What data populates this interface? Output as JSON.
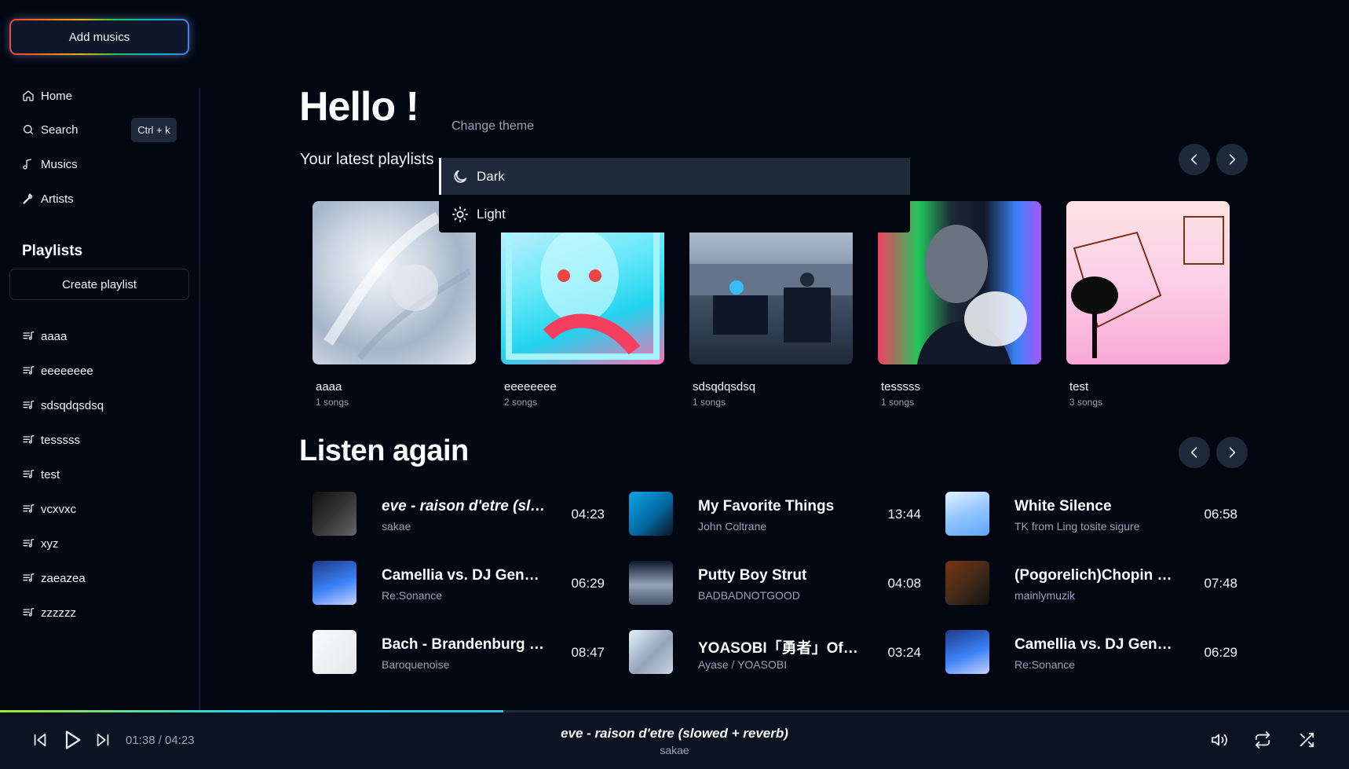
{
  "sidebar": {
    "add_label": "Add musics",
    "nav": [
      {
        "label": "Home",
        "icon": "home-icon"
      },
      {
        "label": "Search",
        "icon": "search-icon",
        "shortcut": "Ctrl + k"
      },
      {
        "label": "Musics",
        "icon": "music-note-icon"
      },
      {
        "label": "Artists",
        "icon": "microphone-icon"
      }
    ],
    "playlists_title": "Playlists",
    "create_label": "Create playlist",
    "playlists": [
      "aaaa",
      "eeeeeeee",
      "sdsqdqsdsq",
      "tesssss",
      "test",
      "vcxvxc",
      "xyz",
      "zaeazea",
      "zzzzzz"
    ]
  },
  "main": {
    "greeting": "Hello !",
    "latest_title": "Your latest playlists",
    "cards": [
      {
        "name": "aaaa",
        "count": "1 songs"
      },
      {
        "name": "eeeeeeee",
        "count": "2 songs"
      },
      {
        "name": "sdsqdqsdsq",
        "count": "1 songs"
      },
      {
        "name": "tesssss",
        "count": "1 songs"
      },
      {
        "name": "test",
        "count": "3 songs"
      }
    ],
    "listen_title": "Listen again",
    "tracks": [
      {
        "title": "eve - raison d'etre (slowed + reverb)",
        "artist": "sakae",
        "duration": "04:23"
      },
      {
        "title": "My Favorite Things",
        "artist": "John Coltrane",
        "duration": "13:44"
      },
      {
        "title": "White Silence",
        "artist": "TK from Ling tosite sigure",
        "duration": "06:58"
      },
      {
        "title": "Camellia vs. DJ Genki - Re:Sonance",
        "artist": "Re:Sonance",
        "duration": "06:29"
      },
      {
        "title": "Putty Boy Strut",
        "artist": "BADBADNOTGOOD",
        "duration": "04:08"
      },
      {
        "title": "(Pogorelich)Chopin Scherzo",
        "artist": "mainlymuzik",
        "duration": "07:48"
      },
      {
        "title": "Bach - Brandenburg Concerto",
        "artist": "Baroquenoise",
        "duration": "08:47"
      },
      {
        "title": "YOASOBI「勇者」Official Music Video",
        "artist": "Ayase / YOASOBI",
        "duration": "03:24"
      },
      {
        "title": "Camellia vs. DJ Genki - Re:Sonance",
        "artist": "Re:Sonance",
        "duration": "06:29"
      }
    ]
  },
  "theme_menu": {
    "label": "Change theme",
    "options": [
      {
        "label": "Dark",
        "icon": "moon-icon",
        "selected": true
      },
      {
        "label": "Light",
        "icon": "sun-icon",
        "selected": false
      }
    ]
  },
  "player": {
    "current_time": "01:38",
    "total_time": "04:23",
    "time_display": "01:38 / 04:23",
    "progress": 0.373,
    "title": "eve - raison d'etre (slowed + reverb)",
    "artist": "sakae"
  },
  "colors": {
    "background": "#030712",
    "surface": "#1e293b",
    "muted_text": "#94a3b8"
  }
}
